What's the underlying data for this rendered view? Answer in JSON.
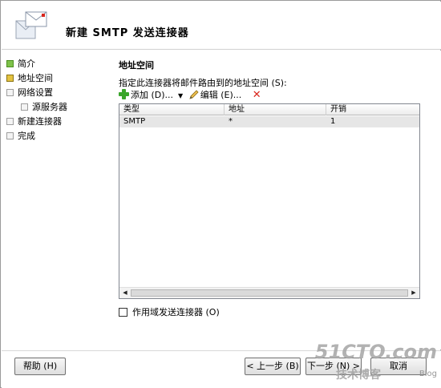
{
  "header": {
    "title": "新建 SMTP 发送连接器",
    "icon": "wizard-mail-icon"
  },
  "nav": {
    "items": [
      {
        "label": "简介",
        "state": "done",
        "indent": false
      },
      {
        "label": "地址空间",
        "state": "active",
        "indent": false
      },
      {
        "label": "网络设置",
        "state": "pending",
        "indent": false
      },
      {
        "label": "源服务器",
        "state": "pending",
        "indent": true
      },
      {
        "label": "新建连接器",
        "state": "pending",
        "indent": false
      },
      {
        "label": "完成",
        "state": "pending",
        "indent": false
      }
    ]
  },
  "main": {
    "section_title": "地址空间",
    "description": "指定此连接器将邮件路由到的地址空间 (S):",
    "toolbar": {
      "add_label": "添加 (D)...",
      "edit_label": "编辑 (E)...",
      "icons": {
        "add": "plus-icon",
        "dropdown": "chevron-down-icon",
        "edit": "pencil-icon",
        "delete": "red-x-icon"
      }
    },
    "table": {
      "columns": [
        "类型",
        "地址",
        "开销"
      ],
      "rows": [
        [
          "SMTP",
          "*",
          "1"
        ]
      ]
    },
    "scope_checkbox": {
      "label": "作用域发送连接器 (O)",
      "checked": false
    }
  },
  "footer": {
    "help": "帮助 (H)",
    "back": "< 上一步 (B)",
    "next": "下一步 (N) >",
    "cancel": "取消"
  },
  "watermark": {
    "site": "51CTO.com",
    "tagline": "技术博客",
    "blog": "Blog"
  },
  "colors": {
    "done": "#7fc24a",
    "active": "#e4c340",
    "delete": "#d9251c",
    "add": "#3aa52b"
  }
}
